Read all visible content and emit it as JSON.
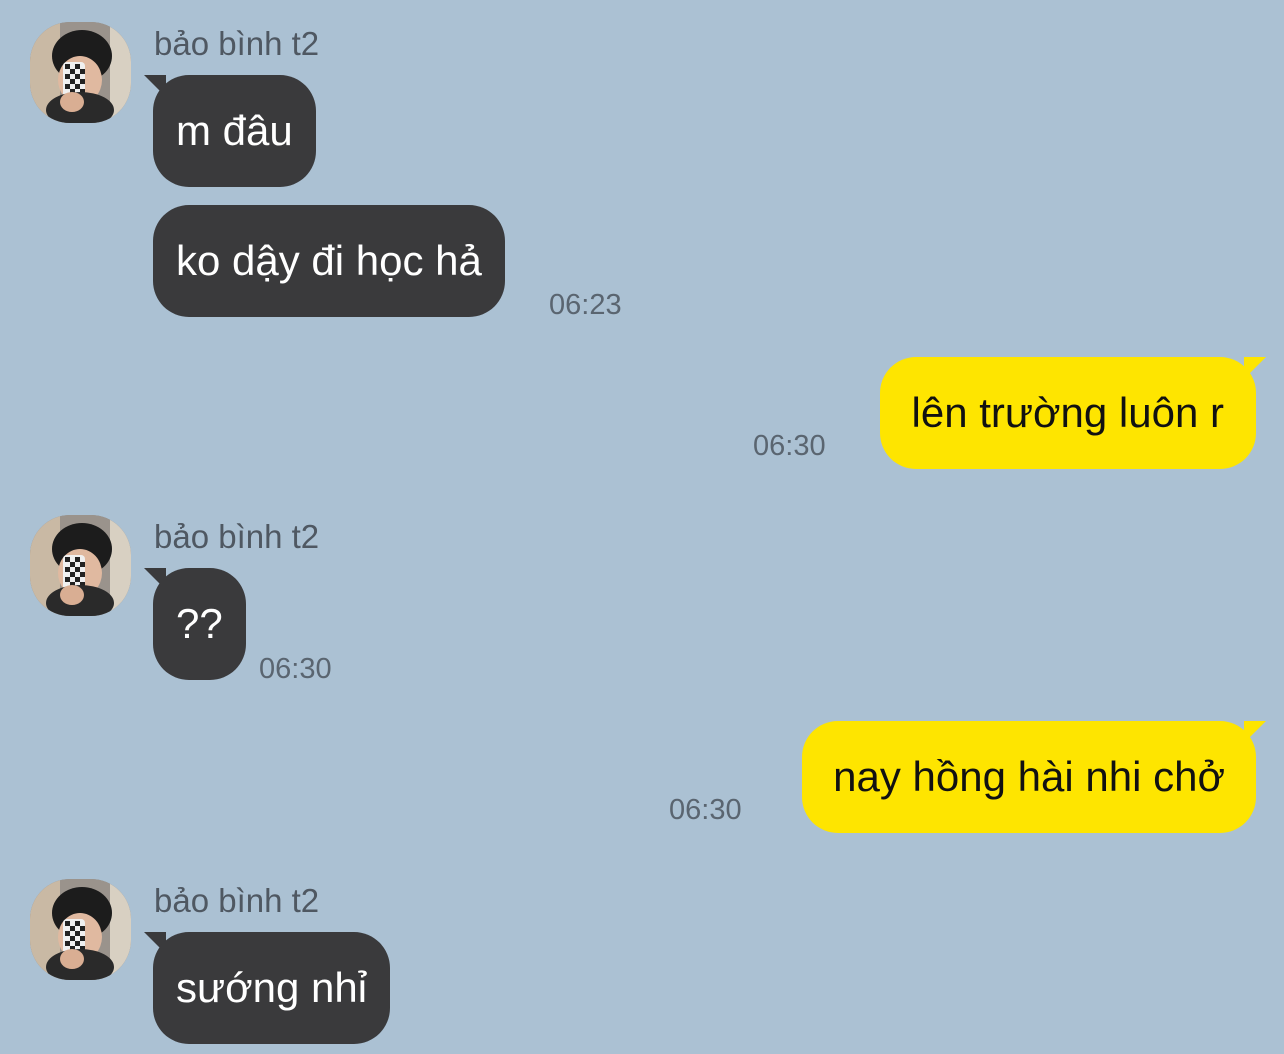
{
  "chat": {
    "sender_name": "bảo bình t2",
    "colors": {
      "background": "#abc1d3",
      "incoming_bubble": "#3a3a3c",
      "outgoing_bubble": "#fee500"
    },
    "messages": [
      {
        "direction": "incoming",
        "text": "m đâu"
      },
      {
        "direction": "incoming",
        "text": "ko dậy đi học hả",
        "time": "06:23"
      },
      {
        "direction": "outgoing",
        "text": "lên trường luôn r",
        "time": "06:30"
      },
      {
        "direction": "incoming",
        "text": "??",
        "time": "06:30"
      },
      {
        "direction": "outgoing",
        "text": "nay hồng hài nhi chở",
        "time": "06:30"
      },
      {
        "direction": "incoming",
        "text": "sướng nhỉ"
      }
    ],
    "avatar_icon": "profile-photo"
  }
}
